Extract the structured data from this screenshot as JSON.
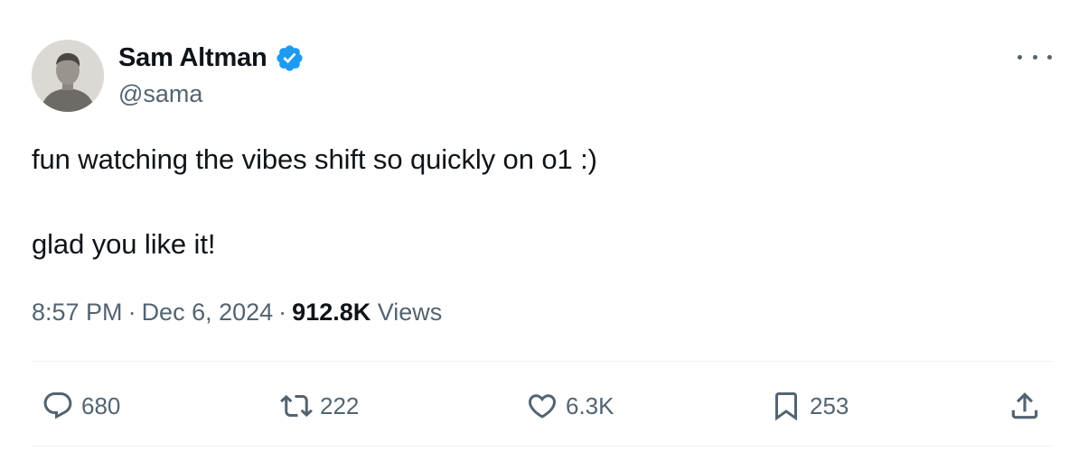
{
  "author": {
    "display_name": "Sam Altman",
    "handle": "@sama",
    "verified": true,
    "verified_icon": "verified-badge-icon",
    "avatar": "profile-photo"
  },
  "tweet": {
    "lines": [
      "fun watching the vibes shift so quickly on o1 :)",
      "glad you like it!"
    ]
  },
  "meta": {
    "time": "8:57 PM",
    "separator": "·",
    "date": "Dec 6, 2024",
    "views_count": "912.8K",
    "views_label": "Views"
  },
  "actions": {
    "reply": {
      "icon": "reply-icon",
      "count": "680"
    },
    "retweet": {
      "icon": "retweet-icon",
      "count": "222"
    },
    "like": {
      "icon": "heart-icon",
      "count": "6.3K"
    },
    "bookmark": {
      "icon": "bookmark-icon",
      "count": "253"
    },
    "share": {
      "icon": "share-icon"
    }
  },
  "colors": {
    "text_primary": "#0f1419",
    "text_secondary": "#536471",
    "verified_blue": "#1d9bf0",
    "divider": "#eff3f4"
  }
}
